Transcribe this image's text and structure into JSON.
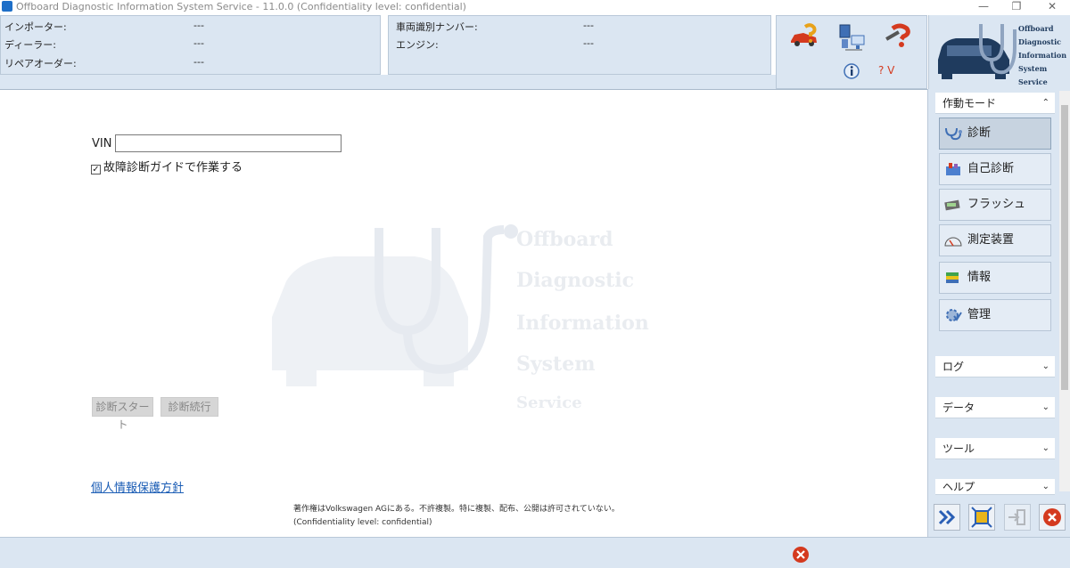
{
  "window": {
    "title": "Offboard Diagnostic Information System Service - 11.0.0 (Confidentiality level: confidential)",
    "minimize_glyph": "—",
    "maximize_glyph": "❐",
    "close_glyph": "✕"
  },
  "header": {
    "importer_label": "インポーター:",
    "importer_value": "---",
    "dealer_label": "ディーラー:",
    "dealer_value": "---",
    "repair_order_label": "リペアオーダー:",
    "repair_order_value": "---",
    "vin_label": "車両識別ナンバー:",
    "vin_value": "---",
    "engine_label": "エンジン:",
    "engine_value": "---",
    "version_hint": "? V"
  },
  "logo": {
    "line1": "Offboard",
    "line2": "Diagnostic",
    "line3": "Information",
    "line4": "System",
    "line5": "Service"
  },
  "main": {
    "vin_field_label": "VIN",
    "vin_value": "",
    "guided_check_label": "故障診断ガイドで作業する",
    "guided_checked": true,
    "start_button": "診断スタート",
    "continue_button": "診断続行",
    "privacy_link": "個人情報保護方針",
    "copyright": "著作権はVolkswagen AGにある。不許複製。特に複製、配布、公開は許可されていない。",
    "confidentiality": "(Confidentiality level: confidential)"
  },
  "sidebar": {
    "mode_header": "作動モード",
    "modes": [
      {
        "label": "診断",
        "active": true
      },
      {
        "label": "自己診断",
        "active": false
      },
      {
        "label": "フラッシュ",
        "active": false
      },
      {
        "label": "測定装置",
        "active": false
      },
      {
        "label": "情報",
        "active": false
      },
      {
        "label": "管理",
        "active": false
      }
    ],
    "log_header": "ログ",
    "data_header": "データ",
    "tools_header": "ツール",
    "help_header": "ヘルプ"
  },
  "colors": {
    "panel": "#dbe6f2",
    "border": "#b9c8d8",
    "link": "#1b5db5",
    "logo_navy": "#1f3b5e"
  }
}
